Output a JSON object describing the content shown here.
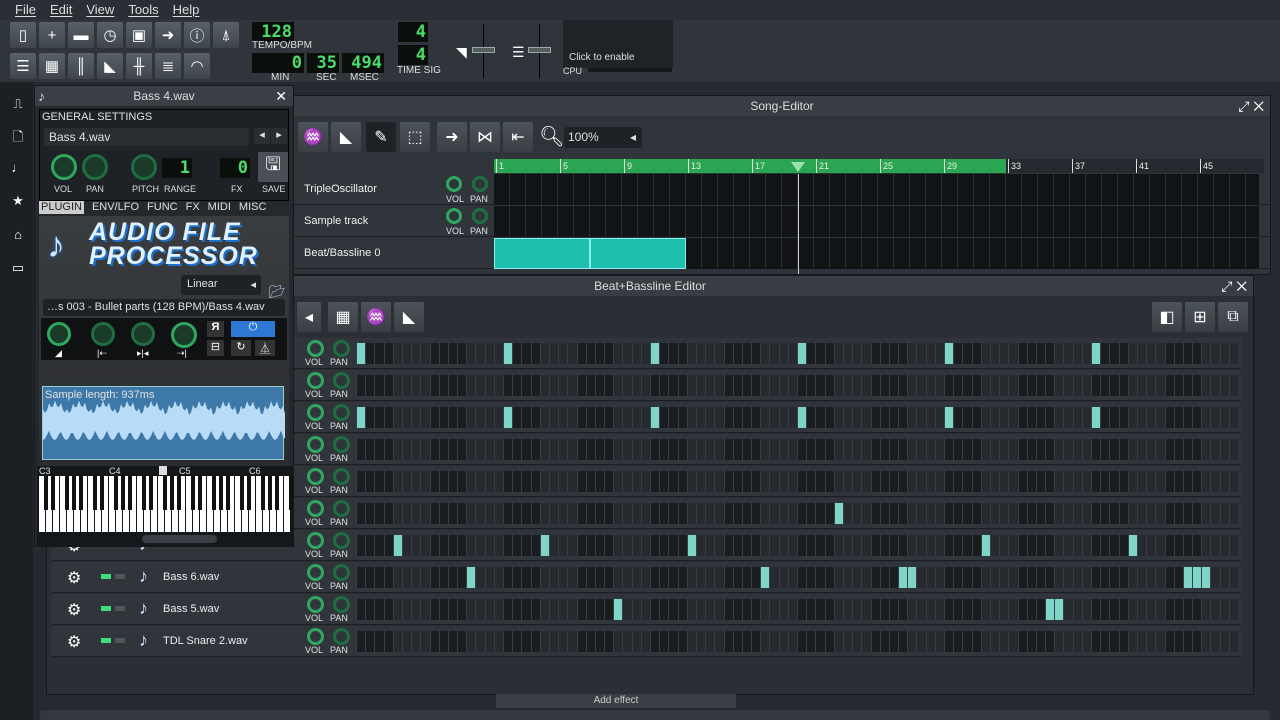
{
  "menu": [
    "File",
    "Edit",
    "View",
    "Tools",
    "Help"
  ],
  "toolbar": {
    "tempo": "128",
    "tempo_label": "TEMPO/BPM",
    "min": "0",
    "sec": "35",
    "msec": "494",
    "min_label": "MIN",
    "sec_label": "SEC",
    "msec_label": "MSEC",
    "timesig_num": "4",
    "timesig_den": "4",
    "timesig_label": "TIME SIG",
    "cpu_hint": "Click to enable",
    "cpu_label": "CPU",
    "buttons": [
      "new-file",
      "new-from-template",
      "open",
      "recent",
      "save",
      "export",
      "about",
      "metronome"
    ],
    "view_buttons": [
      "song-editor",
      "beat-bassline-editor",
      "piano-roll",
      "automation-editor",
      "fx-mixer",
      "project-notes",
      "controller-rack"
    ]
  },
  "sidebar": [
    "my-projects",
    "my-samples",
    "my-presets",
    "my-home",
    "root",
    "computer"
  ],
  "instrument": {
    "title": "Bass 4.wav",
    "general": "GENERAL SETTINGS",
    "name": "Bass 4.wav",
    "knobs": [
      "VOL",
      "PAN",
      "PITCH"
    ],
    "range_label": "RANGE",
    "range": "1",
    "fx_label": "FX",
    "fx": "0",
    "save": "SAVE",
    "tabs": [
      "PLUGIN",
      "ENV/LFO",
      "FUNC",
      "FX",
      "MIDI",
      "MISC"
    ],
    "logo": "AUDIO FILE PROCESSOR",
    "interp": "Linear",
    "file": "…s 003 - Bullet parts (128 BPM)/Bass 4.wav",
    "sample_length": "Sample length: 937ms",
    "octaves": [
      "C3",
      "C4",
      "C5",
      "C6"
    ]
  },
  "song": {
    "title": "Song-Editor",
    "zoom": "100%",
    "bars": [
      "1",
      "5",
      "9",
      "13",
      "17",
      "21",
      "25",
      "29",
      "33",
      "37",
      "41",
      "45"
    ],
    "loop_end_bar": 33,
    "playhead_bar": 20,
    "tracks": [
      {
        "name": "TripleOscillator"
      },
      {
        "name": "Sample track"
      },
      {
        "name": "Beat/Bassline 0",
        "blocks": [
          [
            1,
            7
          ],
          [
            7,
            13
          ]
        ]
      }
    ],
    "vol": "VOL",
    "pan": "PAN"
  },
  "bb": {
    "title": "Beat+Bassline Editor",
    "steps_per_row": 96,
    "rows": [
      {
        "name": "",
        "steps": [
          0,
          16,
          32,
          48,
          64,
          80
        ]
      },
      {
        "name": "",
        "steps": []
      },
      {
        "name": "",
        "steps": [
          0,
          16,
          32,
          48,
          64,
          80
        ]
      },
      {
        "name": "",
        "steps": []
      },
      {
        "name": "",
        "steps": []
      },
      {
        "name": "",
        "steps": [
          52
        ]
      },
      {
        "name": "",
        "steps": [
          4,
          20,
          36,
          68,
          84
        ]
      },
      {
        "name": "Bass 6.wav",
        "steps": [
          12,
          44,
          59,
          60,
          90,
          91,
          92
        ]
      },
      {
        "name": "Bass 5.wav",
        "steps": [
          28,
          75,
          76
        ]
      },
      {
        "name": "TDL Snare 2.wav",
        "steps": []
      }
    ]
  },
  "fx": {
    "add_effect": "Add effect"
  },
  "colors": {
    "accent": "#2fa85f",
    "step_on": "#7fd4c8",
    "block": "#1fbfb0"
  }
}
